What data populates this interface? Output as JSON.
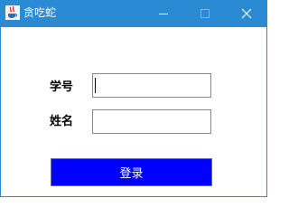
{
  "window": {
    "title": "贪吃蛇",
    "title_bar_color": "#2a8ad4",
    "icons": {
      "app": "java-cup-icon",
      "minimize": "minimize-icon",
      "maximize": "maximize-icon",
      "close": "close-icon"
    }
  },
  "form": {
    "student_id_label": "学号",
    "student_id_value": "",
    "name_label": "姓名",
    "name_value": "",
    "login_button": "登录",
    "login_button_color": "#0000ff"
  }
}
